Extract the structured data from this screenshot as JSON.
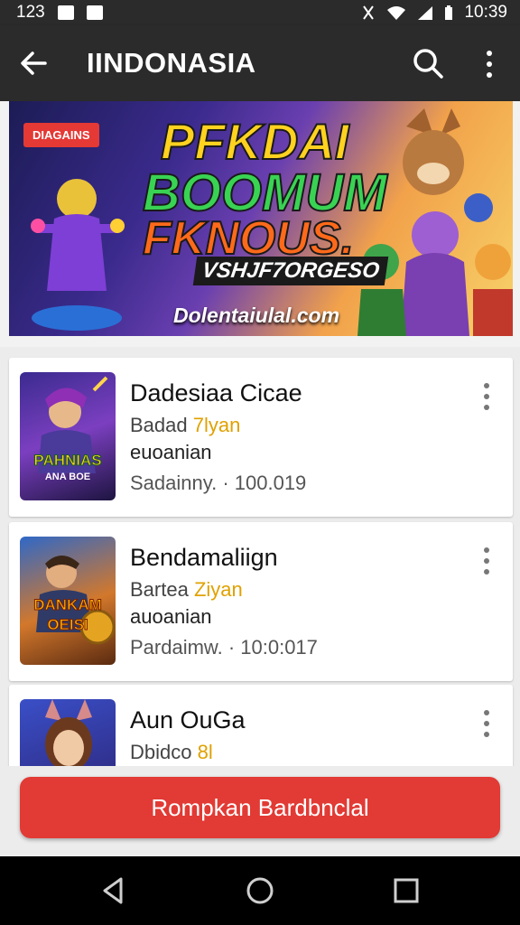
{
  "status_bar": {
    "left_text": "123",
    "time": "10:39"
  },
  "app_bar": {
    "title": "IINDONASIA"
  },
  "banner": {
    "badge": "DIAGAINS",
    "line1": "PFKDAI",
    "line2": "BOOMUM",
    "line3": "FKNOUS.",
    "line4": "VSHJF7ORGESO",
    "url": "Dolentaiulal.com"
  },
  "apps": [
    {
      "name": "Dadesiaa Cicae",
      "dev_prefix": "Badad",
      "dev_accent": "7lyan",
      "category": "euoanian",
      "meta": "Sadainny. · 100.019",
      "thumb_text": "PAHNIAS",
      "thumb_sub": "ANA BOE"
    },
    {
      "name": "Bendamaliign",
      "dev_prefix": "Bartea",
      "dev_accent": "Ziyan",
      "category": "auoanian",
      "meta": "Pardaimw. · 10:0:017",
      "thumb_text": "DANKAM",
      "thumb_sub": "OEISI"
    },
    {
      "name": "Aun OuGa",
      "dev_prefix": "Dbidco",
      "dev_accent": "8l",
      "category": "",
      "meta": ""
    }
  ],
  "cta": {
    "label": "Rompkan Bardbnclal"
  },
  "colors": {
    "accent": "#e23a34",
    "bar": "#2b2b2b",
    "dev_accent": "#e0a100"
  }
}
